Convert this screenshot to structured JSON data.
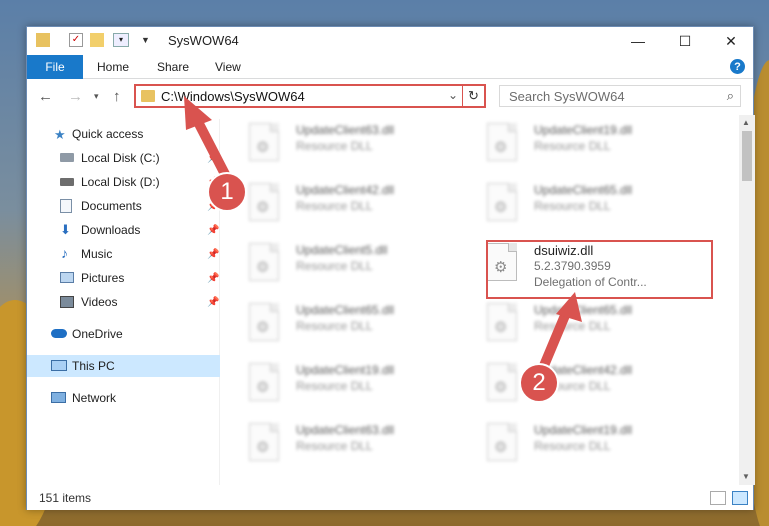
{
  "window": {
    "title": "SysWOW64",
    "controls": {
      "minimize": "—",
      "maximize": "☐",
      "close": "✕"
    }
  },
  "ribbon": {
    "tabs": [
      "File",
      "Home",
      "Share",
      "View"
    ],
    "help": "?"
  },
  "nav": {
    "address_path": "C:\\Windows\\SysWOW64",
    "search_placeholder": "Search SysWOW64"
  },
  "sidebar": {
    "items": [
      {
        "label": "Quick access",
        "icon": "star-icon"
      },
      {
        "label": "Local Disk (C:)",
        "icon": "drive-icon"
      },
      {
        "label": "Local Disk (D:)",
        "icon": "drive-icon"
      },
      {
        "label": "Documents",
        "icon": "documents-icon"
      },
      {
        "label": "Downloads",
        "icon": "download-icon"
      },
      {
        "label": "Music",
        "icon": "music-icon"
      },
      {
        "label": "Pictures",
        "icon": "pictures-icon"
      },
      {
        "label": "Videos",
        "icon": "videos-icon"
      },
      {
        "label": "OneDrive",
        "icon": "cloud-icon"
      },
      {
        "label": "This PC",
        "icon": "computer-icon"
      },
      {
        "label": "Network",
        "icon": "network-icon"
      }
    ]
  },
  "files": [
    {
      "name": "UpdateClient63.dll",
      "line2": "Resource DLL"
    },
    {
      "name": "UpdateClient19.dll",
      "line2": "Resource DLL"
    },
    {
      "name": "UpdateClient42.dll",
      "line2": "Resource DLL"
    },
    {
      "name": "UpdateClient65.dll",
      "line2": "Resource DLL"
    },
    {
      "name": "UpdateClient5.dll",
      "line2": "Resource DLL"
    },
    {
      "name": "dsuiwiz.dll",
      "line2": "5.2.3790.3959",
      "line3": "Delegation of Contr..."
    },
    {
      "name": "UpdateClient65.dll",
      "line2": "Resource DLL"
    },
    {
      "name": "UpdateClient65.dll",
      "line2": "Resource DLL"
    },
    {
      "name": "UpdateClient19.dll",
      "line2": "Resource DLL"
    },
    {
      "name": "UpdateClient42.dll",
      "line2": "Resource DLL"
    },
    {
      "name": "UpdateClient63.dll",
      "line2": "Resource DLL"
    },
    {
      "name": "UpdateClient19.dll",
      "line2": "Resource DLL"
    }
  ],
  "status": {
    "item_count": "151 items"
  },
  "callouts": {
    "one": "1",
    "two": "2"
  },
  "colors": {
    "accent": "#1979ca",
    "highlight": "#d9534f",
    "selected": "#cce8ff"
  }
}
